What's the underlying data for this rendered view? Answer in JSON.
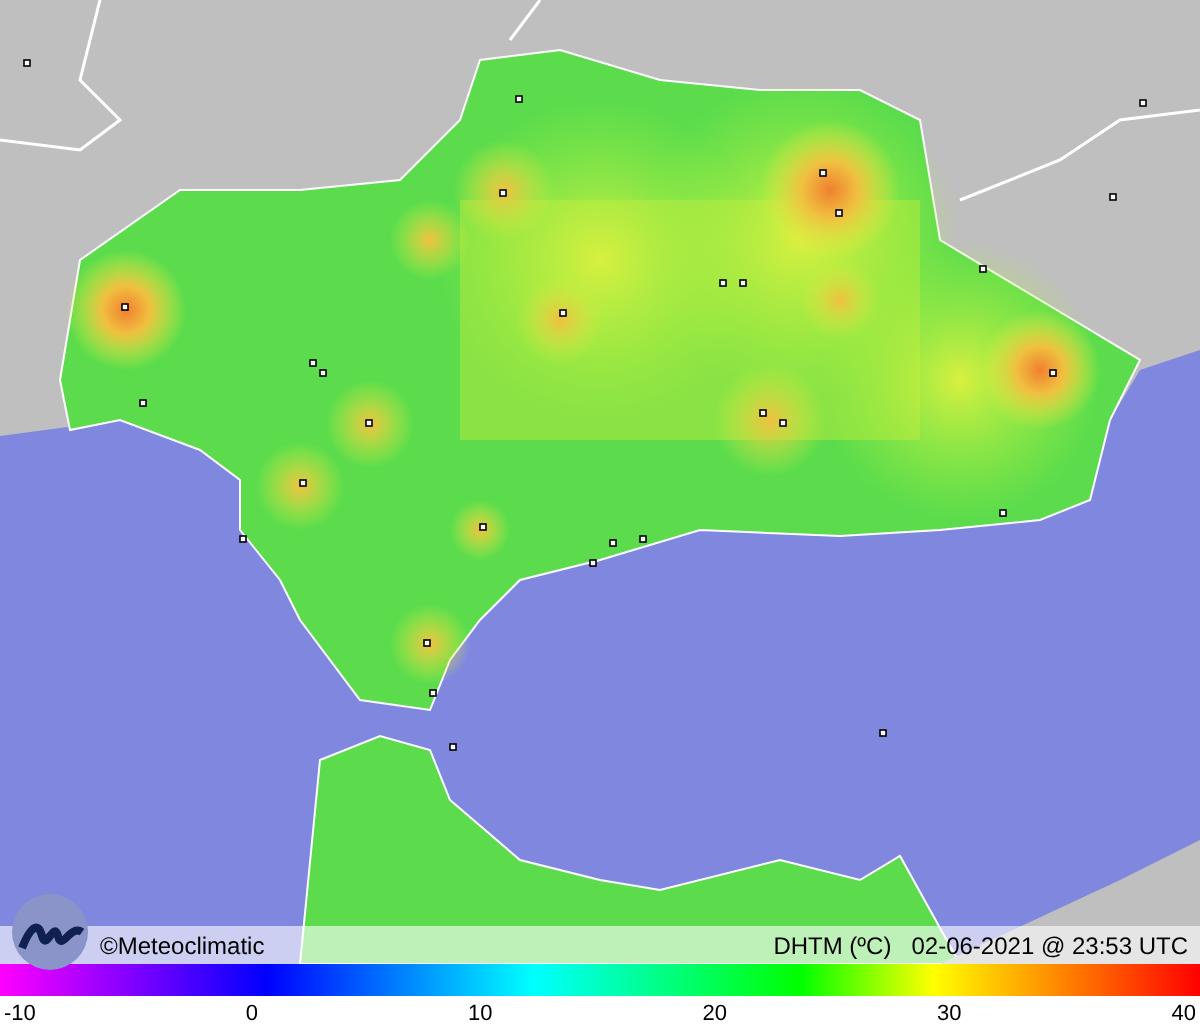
{
  "footer": {
    "copyright": "©Meteoclimatic",
    "variable": "DHTM (ºC)",
    "timestamp": "02-06-2021 @ 23:53 UTC"
  },
  "legend": {
    "ticks": [
      "-10",
      "0",
      "10",
      "20",
      "30",
      "40"
    ]
  }
}
